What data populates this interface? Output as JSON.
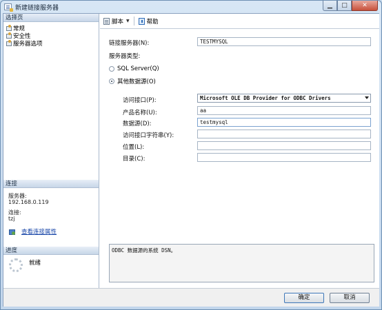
{
  "window": {
    "title": "新建链接服务器"
  },
  "left": {
    "select_page_header": "选择页",
    "pages": [
      {
        "label": "常规",
        "icon": "page-icon"
      },
      {
        "label": "安全性",
        "icon": "page-icon"
      },
      {
        "label": "服务器选项",
        "icon": "page-icon"
      }
    ],
    "connection_header": "连接",
    "server_label": "服务器:",
    "server_value": "192.168.0.119",
    "connection_label": "连接:",
    "connection_value": "tzj",
    "view_props_link": "查看连接属性",
    "progress_header": "进度",
    "progress_status": "就绪"
  },
  "toolbar": {
    "script_label": "脚本",
    "help_label": "帮助"
  },
  "form": {
    "linked_server_label": "链接服务器(N):",
    "linked_server_value": "TESTMYSQL",
    "server_type_label": "服务器类型:",
    "radio_sqlserver_label": "SQL Server(Q)",
    "radio_other_label": "其他数据源(O)",
    "provider_label": "访问接口(P):",
    "provider_value": "Microsoft OLE DB Provider for ODBC Drivers",
    "product_name_label": "产品名称(U):",
    "product_name_value": "aa",
    "data_source_label": "数据源(D):",
    "data_source_value": "testmysql",
    "provider_string_label": "访问接口字符串(Y):",
    "provider_string_value": "",
    "location_label": "位置(L):",
    "location_value": "",
    "catalog_label": "目录(C):",
    "catalog_value": ""
  },
  "description": "ODBC 数据源的系统 DSN。",
  "buttons": {
    "ok": "确定",
    "cancel": "取消"
  },
  "colors": {
    "accent": "#3d77b8",
    "link": "#1846a8"
  }
}
